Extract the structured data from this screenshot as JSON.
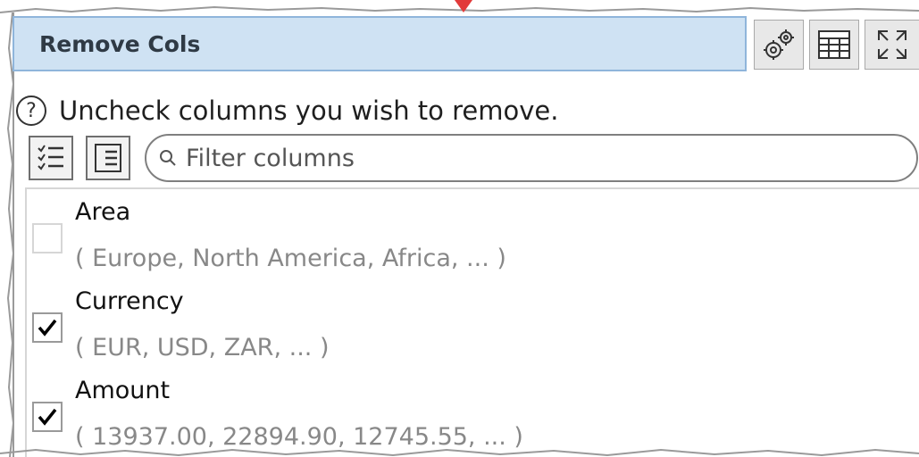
{
  "header": {
    "title": "Remove Cols"
  },
  "header_buttons": [
    {
      "icon": "gear-icon"
    },
    {
      "icon": "table-icon"
    },
    {
      "icon": "expand-icon"
    }
  ],
  "help": {
    "icon_glyph": "?",
    "text": "Uncheck columns you wish to remove."
  },
  "toolbar": {
    "select_all_icon": "checklist-icon",
    "select_none_icon": "list-icon"
  },
  "filter": {
    "placeholder": "Filter columns",
    "value": "",
    "icon": "search-icon"
  },
  "columns": [
    {
      "name": "Area",
      "values": "( Europe, North America, Africa, ... )",
      "checked": false
    },
    {
      "name": "Currency",
      "values": "( EUR, USD, ZAR, ... )",
      "checked": true
    },
    {
      "name": "Amount",
      "values": "( 13937.00, 22894.90, 12745.55, ... )",
      "checked": true
    }
  ],
  "colors": {
    "title_bg": "#cfe2f3",
    "title_border": "#8fb5db",
    "arrow": "#e23b3b"
  }
}
